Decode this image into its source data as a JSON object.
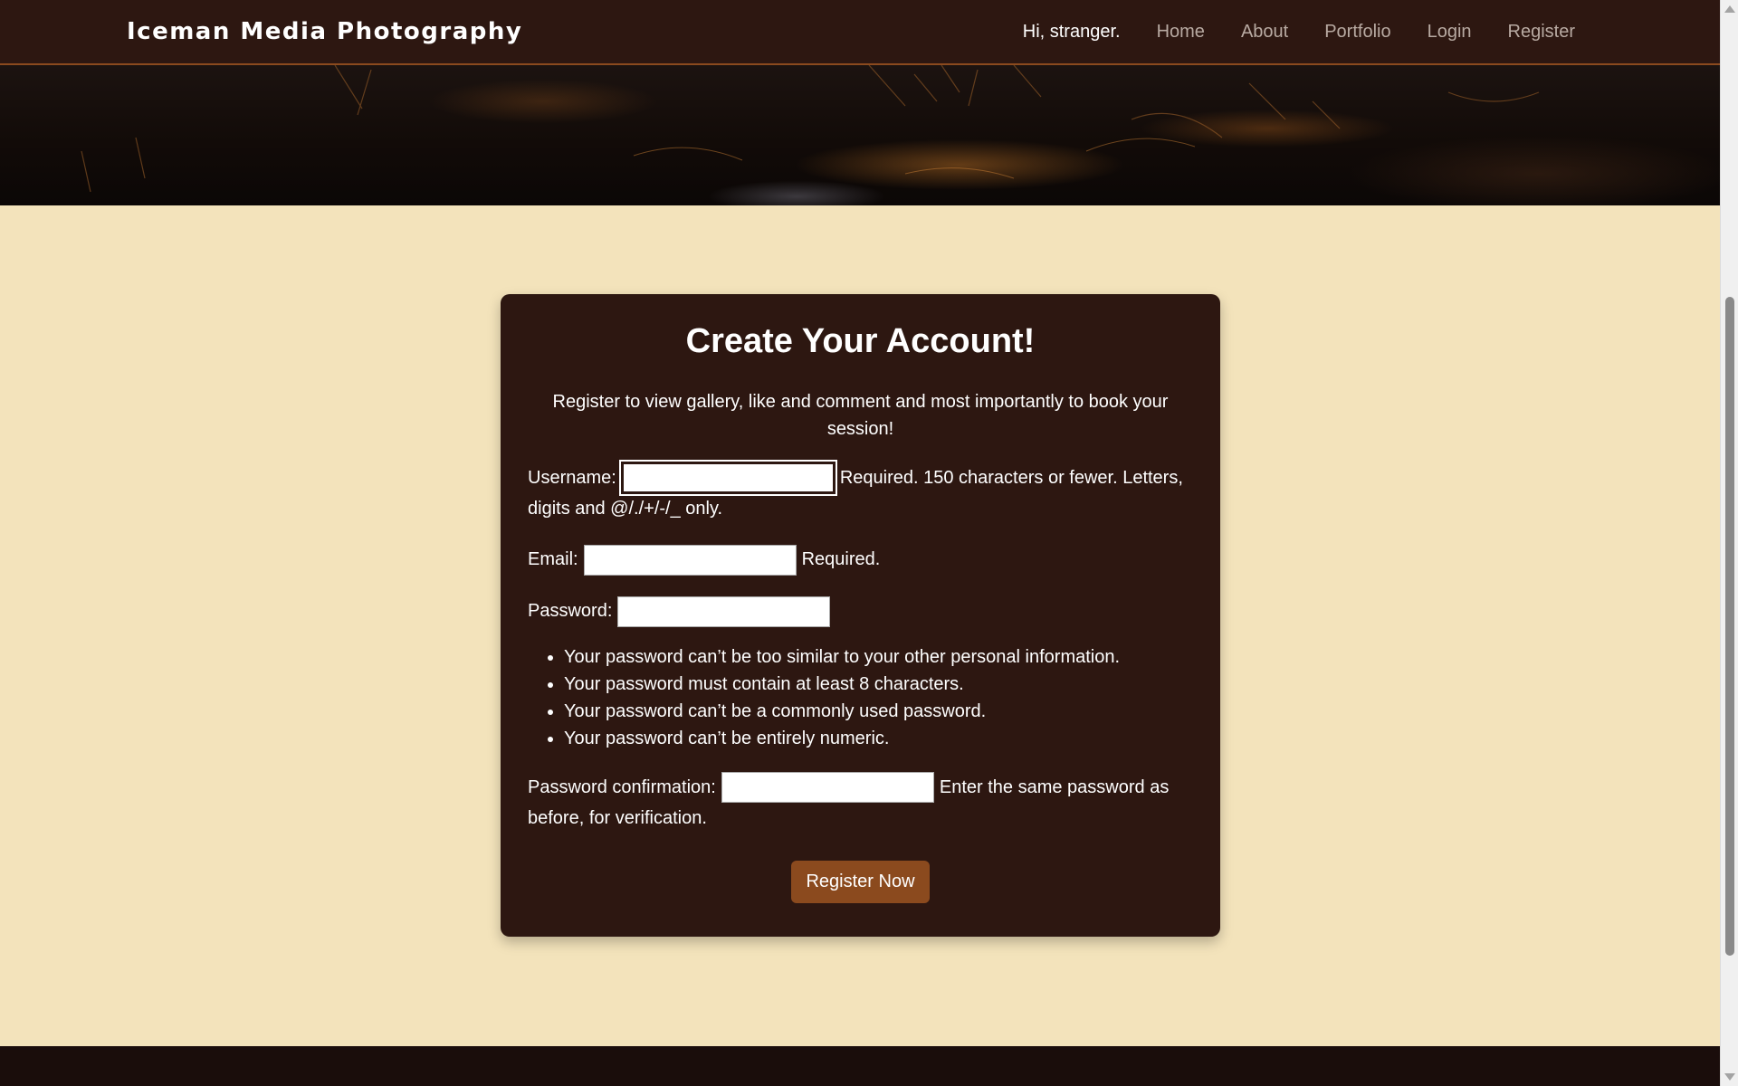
{
  "navbar": {
    "brand": "Iceman Media Photography",
    "greeting": "Hi, stranger.",
    "links": [
      "Home",
      "About",
      "Portfolio",
      "Login",
      "Register"
    ]
  },
  "card": {
    "title": "Create Your Account!",
    "lead": "Register to view gallery, like and comment and most importantly to book your session!",
    "username": {
      "label": "Username:",
      "value": "",
      "help": "Required. 150 characters or fewer. Letters, digits and @/./+/-/_ only."
    },
    "email": {
      "label": "Email:",
      "value": "",
      "help": "Required."
    },
    "password": {
      "label": "Password:",
      "value": "",
      "rules": [
        "Your password can’t be too similar to your other personal information.",
        "Your password must contain at least 8 characters.",
        "Your password can’t be a commonly used password.",
        "Your password can’t be entirely numeric."
      ]
    },
    "password_confirmation": {
      "label": "Password confirmation:",
      "value": "",
      "help": "Enter the same password as before, for verification."
    },
    "submit_label": "Register Now"
  },
  "colors": {
    "navbar_bg": "#2d1711",
    "accent": "#8b4a1e",
    "page_bg": "#f3e3bb",
    "card_bg": "#2d1711",
    "footer_bg": "#1a0d0b"
  }
}
